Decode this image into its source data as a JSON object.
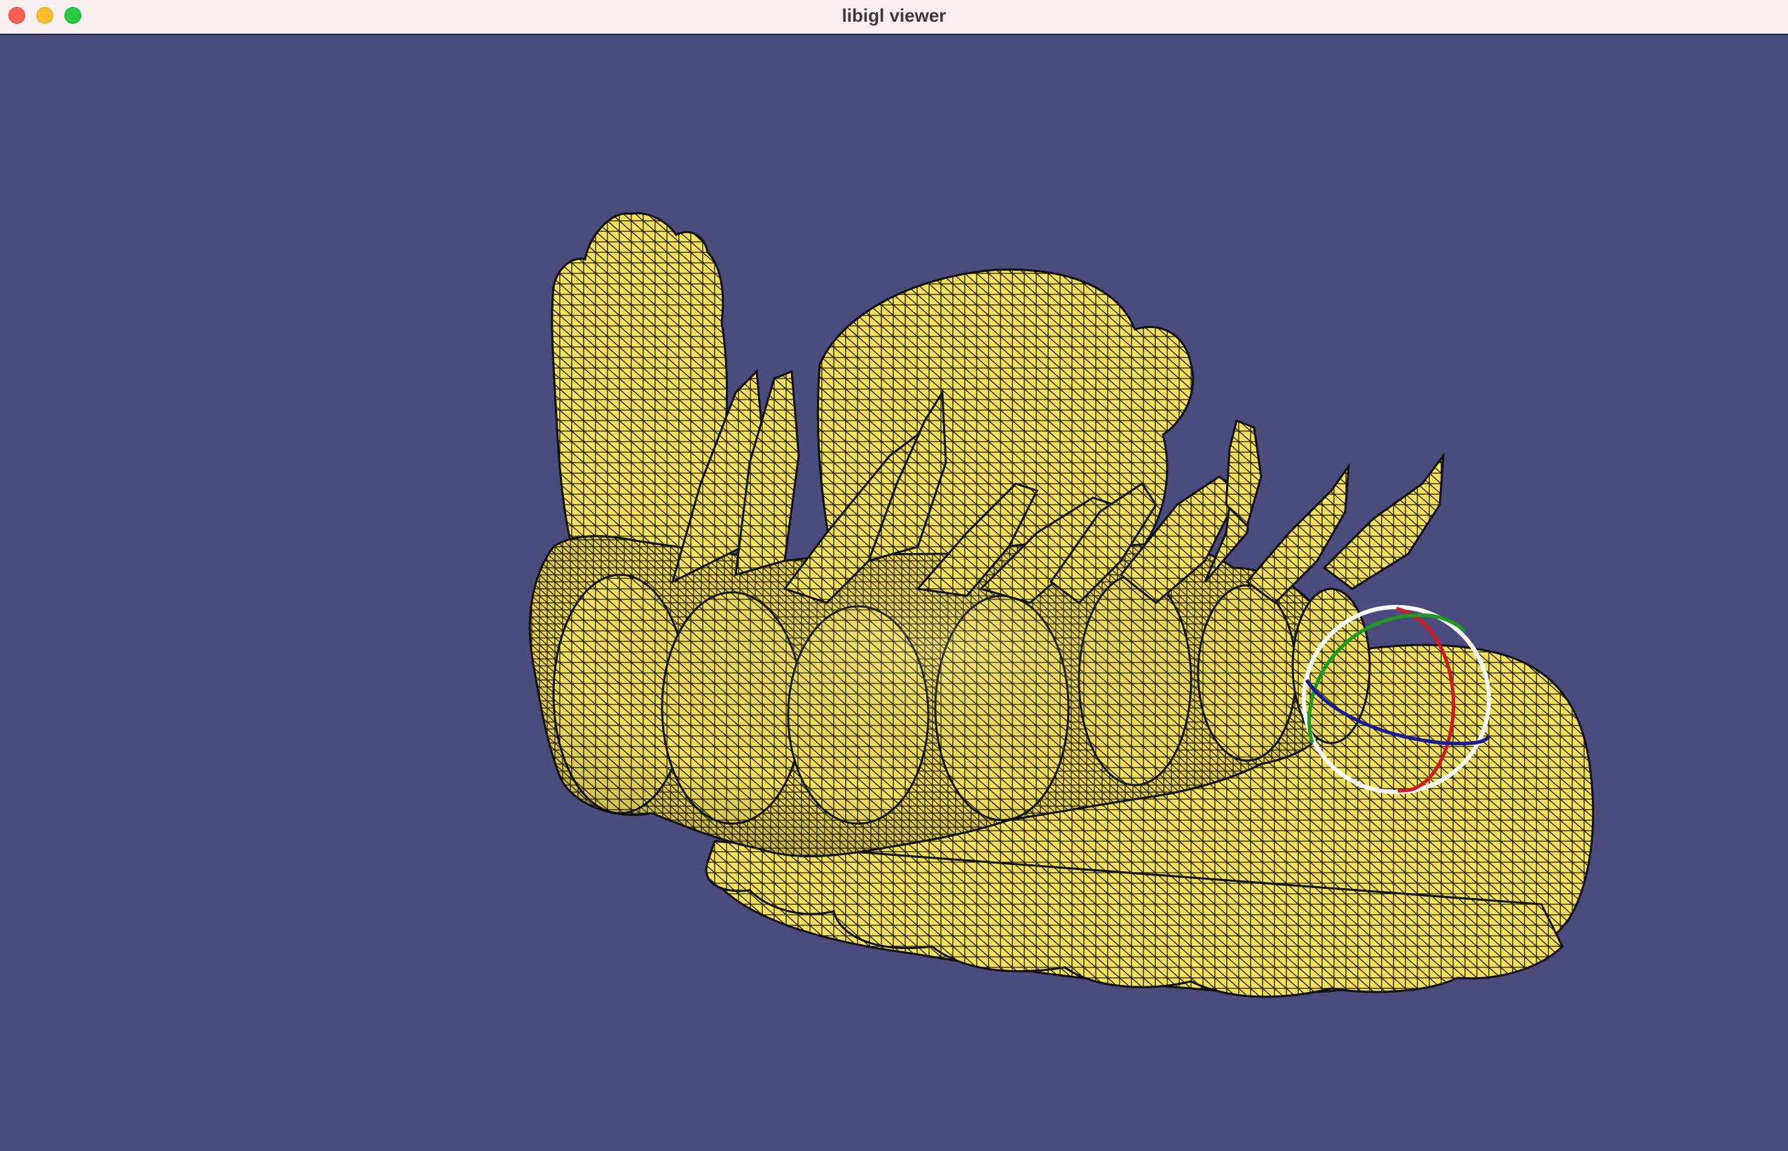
{
  "window": {
    "title": "libigl viewer",
    "controls": [
      "close-button",
      "minimize-button",
      "zoom-button"
    ]
  },
  "viewport": {
    "background_color": "#4b4b7e",
    "mesh_color": "#f4e05a",
    "wireframe_color": "#1a1a10",
    "trackball_colors": {
      "ring": "#ffffff",
      "x_axis": "#cc1f1f",
      "y_axis": "#1e9a1e",
      "z_axis": "#1b1b9a"
    }
  }
}
